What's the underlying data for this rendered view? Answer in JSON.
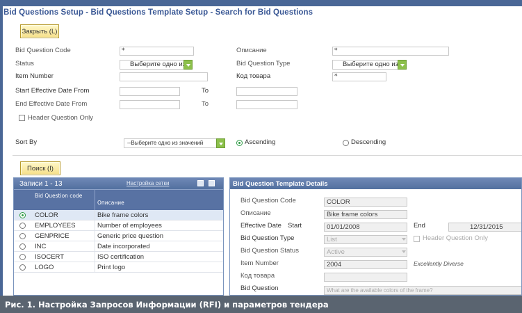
{
  "page_title": "Bid Questions Setup - Bid Questions Template Setup - Search for Bid Questions",
  "buttons": {
    "close": "Закрыть (L)",
    "search": "Поиск (I)"
  },
  "search_form": {
    "question_code_label": "Bid Question Code",
    "question_code_value": "*",
    "description_label": "Описание",
    "description_value": "*",
    "status_label": "Status",
    "status_value": "Выберите одно из",
    "question_type_label": "Bid Question Type",
    "question_type_value": "Выберите одно из",
    "item_number_label": "Item Number",
    "item_code_label": "Код товара",
    "item_code_value": "*",
    "start_date_from_label": "Start Effective Date From",
    "start_to_label": "To",
    "end_date_from_label": "End Effective Date From",
    "end_to_label": "To",
    "header_only_label": "Header Question Only",
    "sort_by_label": "Sort By",
    "sort_by_value": "--Выберите одно из значений",
    "ascending_label": "Ascending",
    "descending_label": "Descending"
  },
  "records": {
    "header": "Записи 1 - 13",
    "link": "Настройка сетки",
    "col_code": "Bid Question code",
    "col_desc": "Описание",
    "rows": [
      {
        "code": "COLOR",
        "desc": "Bike frame colors",
        "selected": true
      },
      {
        "code": "EMPLOYEES",
        "desc": "Number of employees"
      },
      {
        "code": "GENPRICE",
        "desc": "Generic price question"
      },
      {
        "code": "INC",
        "desc": "Date incorporated"
      },
      {
        "code": "ISOCERT",
        "desc": "ISO certification"
      },
      {
        "code": "LOGO",
        "desc": "Print logo"
      }
    ]
  },
  "details": {
    "header": "Bid Question Template Details",
    "code_label": "Bid Question Code",
    "code_value": "COLOR",
    "desc_label": "Описание",
    "desc_value": "Bike frame colors",
    "eff_date_label": "Effective Date",
    "start_label": "Start",
    "start_value": "01/01/2008",
    "end_label": "End",
    "end_value": "12/31/2015",
    "type_label": "Bid Question Type",
    "type_value": "List",
    "header_only_label": "Header Question Only",
    "status_label": "Bid Question Status",
    "status_value": "Active",
    "item_number_label": "Item Number",
    "item_number_value": "2004",
    "item_note": "Excellently Diverse",
    "item_code_label": "Код товара",
    "question_label": "Bid Question",
    "question_value": "What are the available colors of the frame?"
  },
  "caption": "Рис. 1. Настройка Запросов Информации (RFI) и параметров тендера"
}
